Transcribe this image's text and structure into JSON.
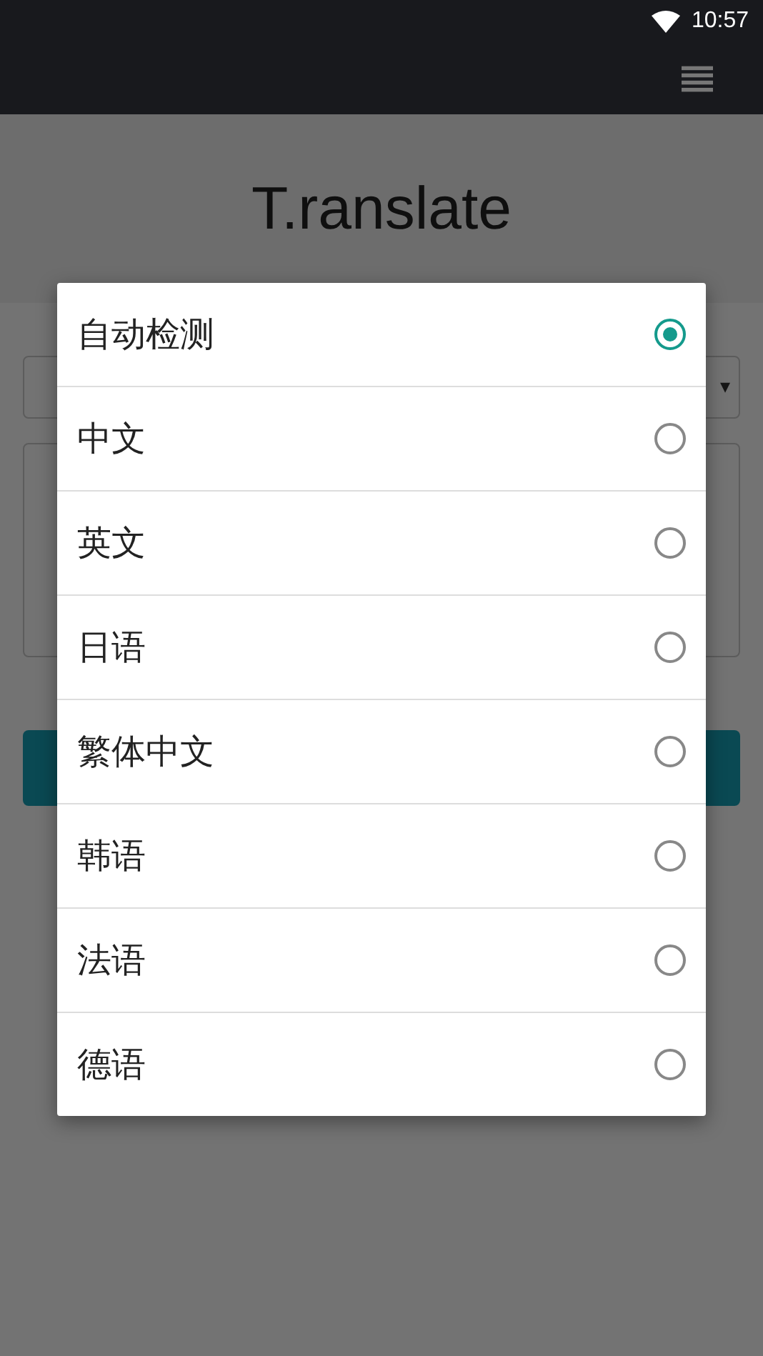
{
  "status_bar": {
    "time": "10:57"
  },
  "header": {
    "title": "T.ranslate"
  },
  "form": {
    "select_arrow": "▾"
  },
  "language_dialog": {
    "options": [
      {
        "label": "自动检测",
        "selected": true
      },
      {
        "label": "中文",
        "selected": false
      },
      {
        "label": "英文",
        "selected": false
      },
      {
        "label": "日语",
        "selected": false
      },
      {
        "label": "繁体中文",
        "selected": false
      },
      {
        "label": "韩语",
        "selected": false
      },
      {
        "label": "法语",
        "selected": false
      },
      {
        "label": "德语",
        "selected": false
      }
    ]
  }
}
